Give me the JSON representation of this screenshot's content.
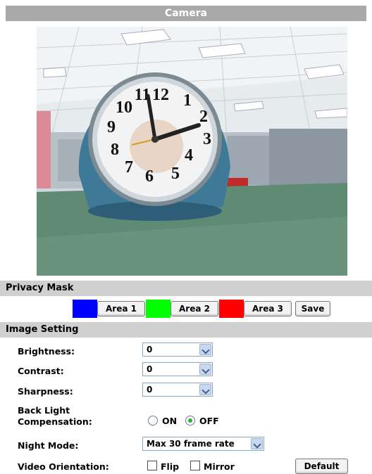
{
  "header": {
    "title": "Camera"
  },
  "camera": {
    "clock_numbers": [
      "12",
      "1",
      "2",
      "3",
      "4",
      "5",
      "6",
      "7",
      "8",
      "9",
      "10",
      "11"
    ]
  },
  "privacy_mask": {
    "title": "Privacy Mask",
    "areas": [
      {
        "label": "Area 1",
        "color": "#0000ff"
      },
      {
        "label": "Area 2",
        "color": "#00ff00"
      },
      {
        "label": "Area 3",
        "color": "#ff0000"
      }
    ],
    "save_label": "Save"
  },
  "image_setting": {
    "title": "Image Setting",
    "brightness": {
      "label": "Brightness:",
      "value": "0"
    },
    "contrast": {
      "label": "Contrast:",
      "value": "0"
    },
    "sharpness": {
      "label": "Sharpness:",
      "value": "0"
    },
    "backlight": {
      "label_line1": "Back Light",
      "label_line2": "Compensation:",
      "on_label": "ON",
      "off_label": "OFF",
      "selected": "OFF"
    },
    "night_mode": {
      "label": "Night Mode:",
      "value": "Max 30 frame rate"
    },
    "video_orientation": {
      "label": "Video Orientation:",
      "flip_label": "Flip",
      "mirror_label": "Mirror",
      "flip_checked": false,
      "mirror_checked": false
    },
    "default_label": "Default"
  }
}
